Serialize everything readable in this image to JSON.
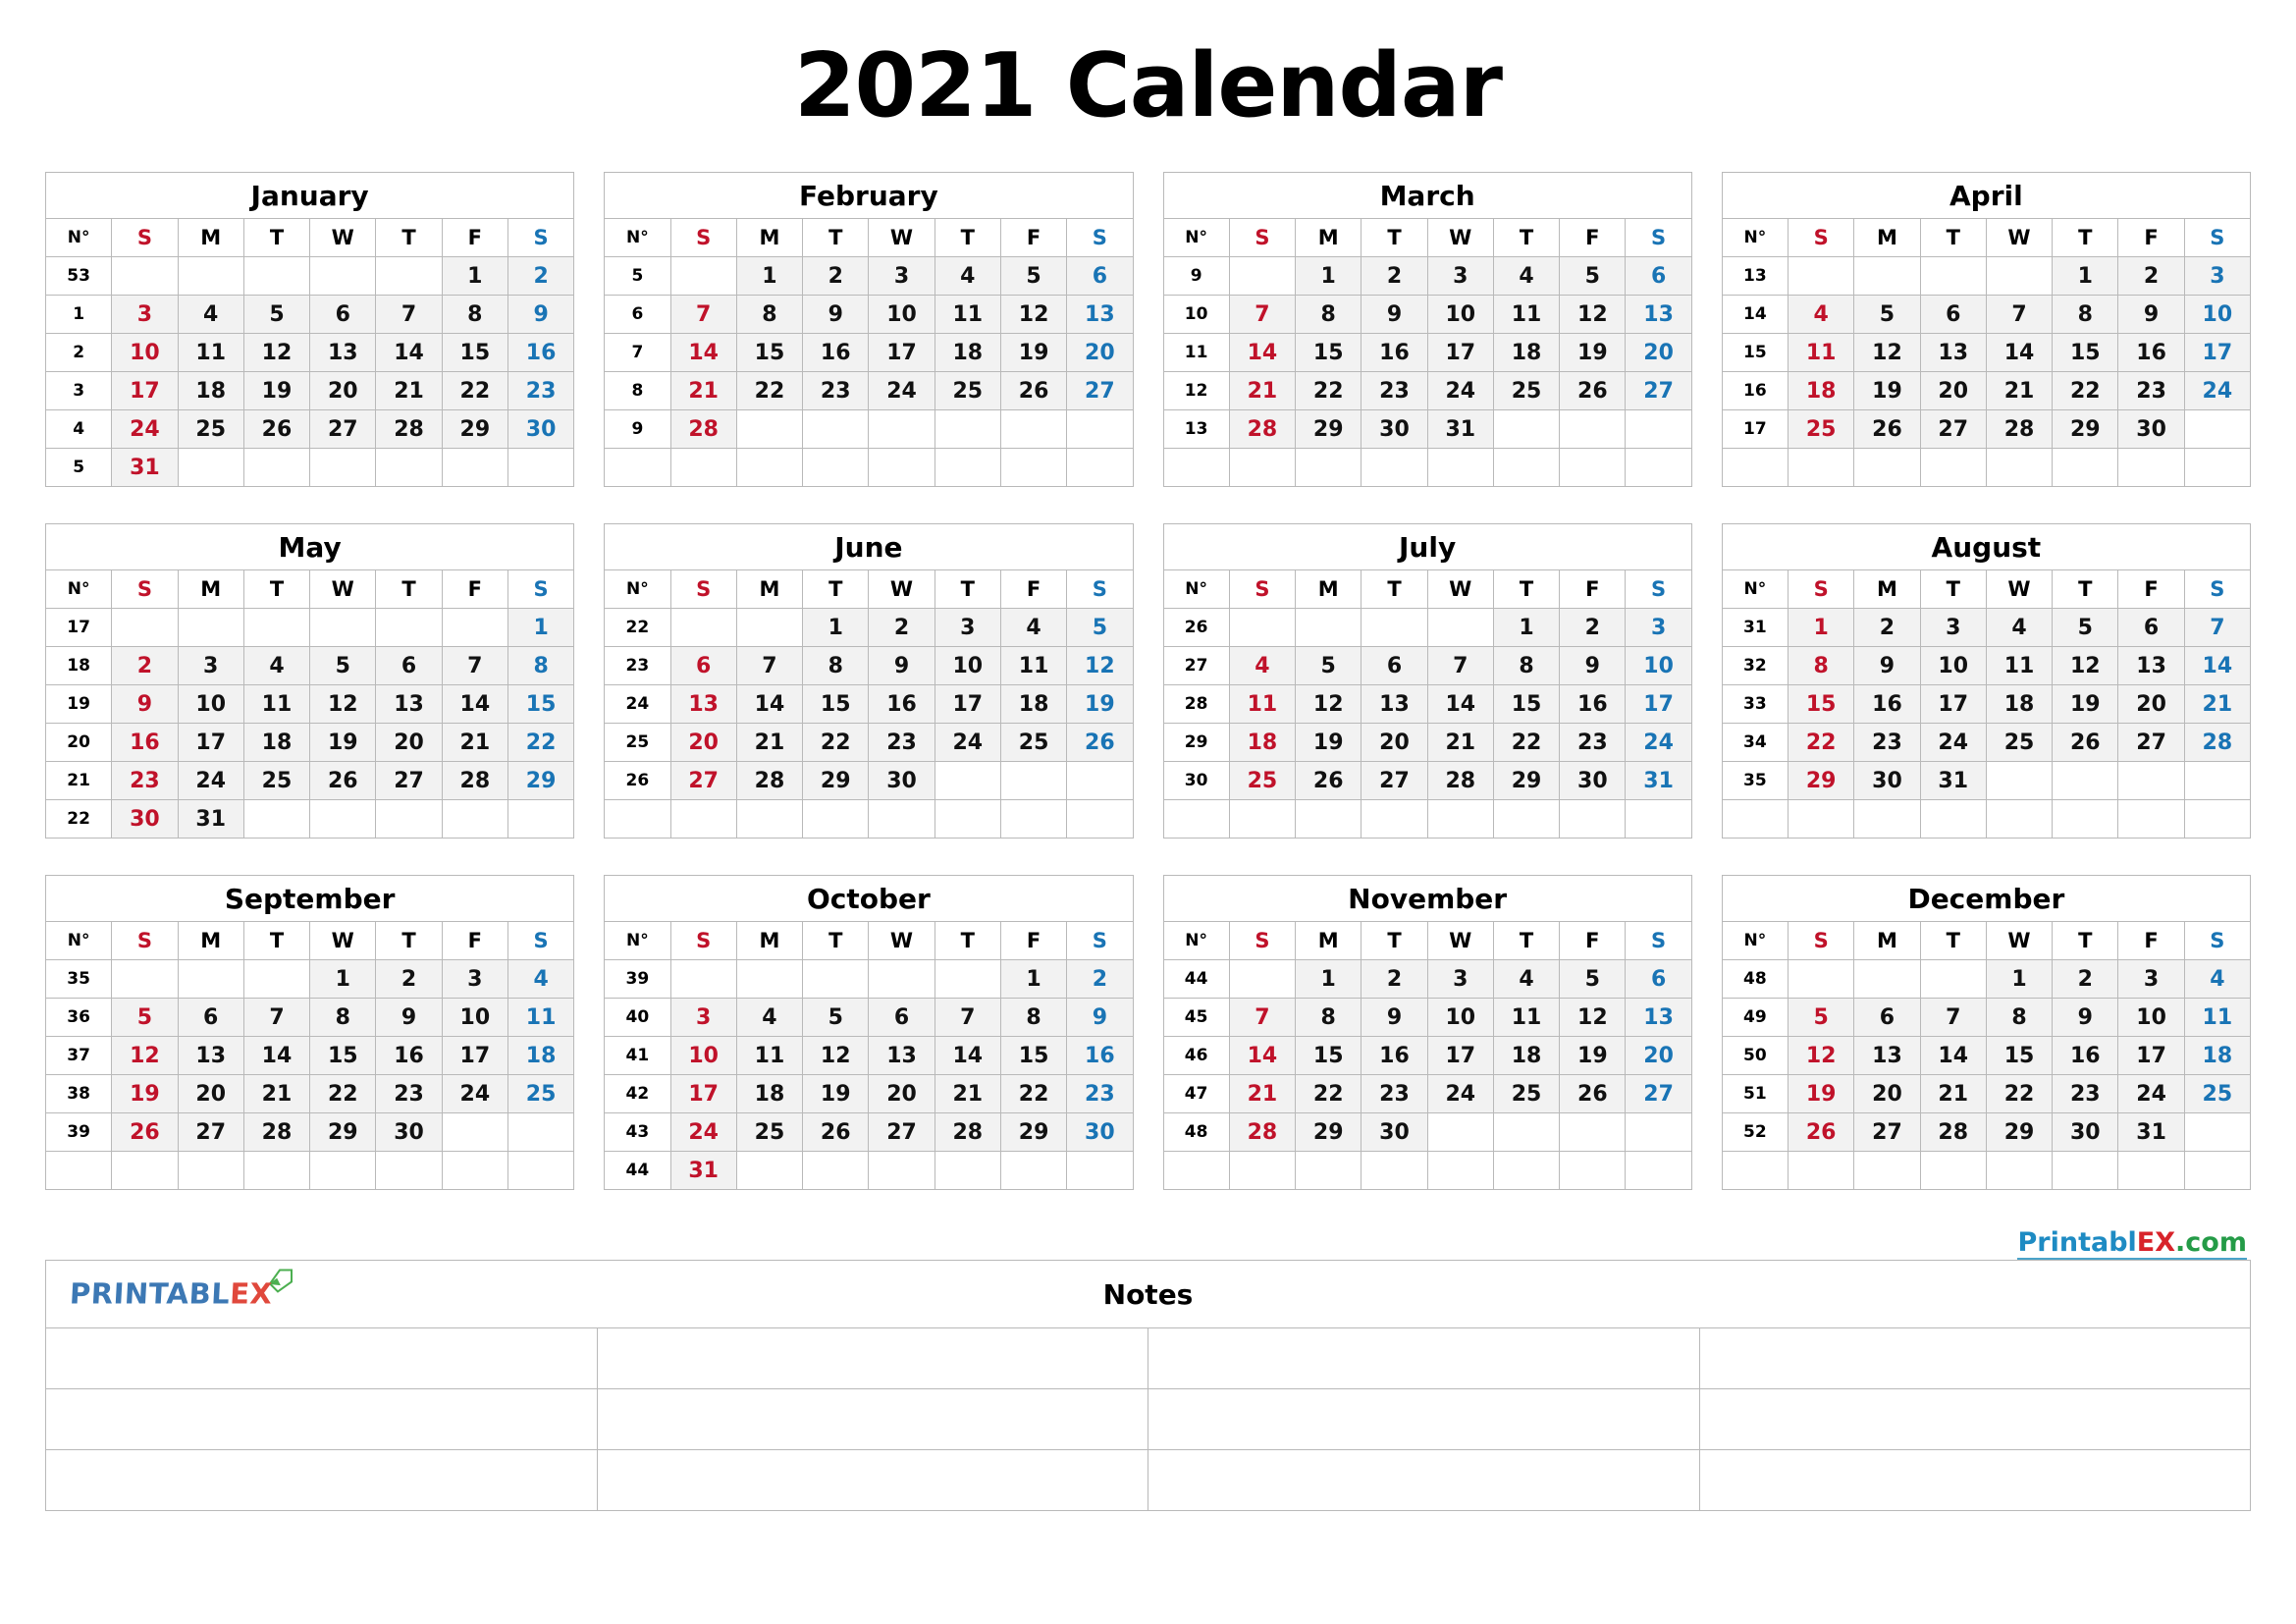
{
  "title": "2021 Calendar",
  "weekday_headers": {
    "week_number": "N°",
    "days": [
      "S",
      "M",
      "T",
      "W",
      "T",
      "F",
      "S"
    ]
  },
  "brand": {
    "top_right": {
      "part1": "Printabl",
      "part2": "EX",
      "part3": ".com"
    },
    "footer_logo": {
      "part1": "PRINTABL",
      "part2": "EX",
      "icon": "tag-icon"
    }
  },
  "notes": {
    "title": "Notes",
    "rows": 3,
    "columns": 4
  },
  "months": [
    {
      "name": "January",
      "weeks": [
        {
          "n": "53",
          "days": [
            "",
            "",
            "",
            "",
            "",
            "1",
            "2"
          ]
        },
        {
          "n": "1",
          "days": [
            "3",
            "4",
            "5",
            "6",
            "7",
            "8",
            "9"
          ]
        },
        {
          "n": "2",
          "days": [
            "10",
            "11",
            "12",
            "13",
            "14",
            "15",
            "16"
          ]
        },
        {
          "n": "3",
          "days": [
            "17",
            "18",
            "19",
            "20",
            "21",
            "22",
            "23"
          ]
        },
        {
          "n": "4",
          "days": [
            "24",
            "25",
            "26",
            "27",
            "28",
            "29",
            "30"
          ]
        },
        {
          "n": "5",
          "days": [
            "31",
            "",
            "",
            "",
            "",
            "",
            ""
          ]
        }
      ]
    },
    {
      "name": "February",
      "weeks": [
        {
          "n": "5",
          "days": [
            "",
            "1",
            "2",
            "3",
            "4",
            "5",
            "6"
          ]
        },
        {
          "n": "6",
          "days": [
            "7",
            "8",
            "9",
            "10",
            "11",
            "12",
            "13"
          ]
        },
        {
          "n": "7",
          "days": [
            "14",
            "15",
            "16",
            "17",
            "18",
            "19",
            "20"
          ]
        },
        {
          "n": "8",
          "days": [
            "21",
            "22",
            "23",
            "24",
            "25",
            "26",
            "27"
          ]
        },
        {
          "n": "9",
          "days": [
            "28",
            "",
            "",
            "",
            "",
            "",
            ""
          ]
        },
        {
          "n": "",
          "days": [
            "",
            "",
            "",
            "",
            "",
            "",
            ""
          ]
        }
      ]
    },
    {
      "name": "March",
      "weeks": [
        {
          "n": "9",
          "days": [
            "",
            "1",
            "2",
            "3",
            "4",
            "5",
            "6"
          ]
        },
        {
          "n": "10",
          "days": [
            "7",
            "8",
            "9",
            "10",
            "11",
            "12",
            "13"
          ]
        },
        {
          "n": "11",
          "days": [
            "14",
            "15",
            "16",
            "17",
            "18",
            "19",
            "20"
          ]
        },
        {
          "n": "12",
          "days": [
            "21",
            "22",
            "23",
            "24",
            "25",
            "26",
            "27"
          ]
        },
        {
          "n": "13",
          "days": [
            "28",
            "29",
            "30",
            "31",
            "",
            "",
            ""
          ]
        },
        {
          "n": "",
          "days": [
            "",
            "",
            "",
            "",
            "",
            "",
            ""
          ]
        }
      ]
    },
    {
      "name": "April",
      "weeks": [
        {
          "n": "13",
          "days": [
            "",
            "",
            "",
            "",
            "1",
            "2",
            "3"
          ]
        },
        {
          "n": "14",
          "days": [
            "4",
            "5",
            "6",
            "7",
            "8",
            "9",
            "10"
          ]
        },
        {
          "n": "15",
          "days": [
            "11",
            "12",
            "13",
            "14",
            "15",
            "16",
            "17"
          ]
        },
        {
          "n": "16",
          "days": [
            "18",
            "19",
            "20",
            "21",
            "22",
            "23",
            "24"
          ]
        },
        {
          "n": "17",
          "days": [
            "25",
            "26",
            "27",
            "28",
            "29",
            "30",
            ""
          ]
        },
        {
          "n": "",
          "days": [
            "",
            "",
            "",
            "",
            "",
            "",
            ""
          ]
        }
      ]
    },
    {
      "name": "May",
      "weeks": [
        {
          "n": "17",
          "days": [
            "",
            "",
            "",
            "",
            "",
            "",
            "1"
          ]
        },
        {
          "n": "18",
          "days": [
            "2",
            "3",
            "4",
            "5",
            "6",
            "7",
            "8"
          ]
        },
        {
          "n": "19",
          "days": [
            "9",
            "10",
            "11",
            "12",
            "13",
            "14",
            "15"
          ]
        },
        {
          "n": "20",
          "days": [
            "16",
            "17",
            "18",
            "19",
            "20",
            "21",
            "22"
          ]
        },
        {
          "n": "21",
          "days": [
            "23",
            "24",
            "25",
            "26",
            "27",
            "28",
            "29"
          ]
        },
        {
          "n": "22",
          "days": [
            "30",
            "31",
            "",
            "",
            "",
            "",
            ""
          ]
        }
      ]
    },
    {
      "name": "June",
      "weeks": [
        {
          "n": "22",
          "days": [
            "",
            "",
            "1",
            "2",
            "3",
            "4",
            "5"
          ]
        },
        {
          "n": "23",
          "days": [
            "6",
            "7",
            "8",
            "9",
            "10",
            "11",
            "12"
          ]
        },
        {
          "n": "24",
          "days": [
            "13",
            "14",
            "15",
            "16",
            "17",
            "18",
            "19"
          ]
        },
        {
          "n": "25",
          "days": [
            "20",
            "21",
            "22",
            "23",
            "24",
            "25",
            "26"
          ]
        },
        {
          "n": "26",
          "days": [
            "27",
            "28",
            "29",
            "30",
            "",
            "",
            ""
          ]
        },
        {
          "n": "",
          "days": [
            "",
            "",
            "",
            "",
            "",
            "",
            ""
          ]
        }
      ]
    },
    {
      "name": "July",
      "weeks": [
        {
          "n": "26",
          "days": [
            "",
            "",
            "",
            "",
            "1",
            "2",
            "3"
          ]
        },
        {
          "n": "27",
          "days": [
            "4",
            "5",
            "6",
            "7",
            "8",
            "9",
            "10"
          ]
        },
        {
          "n": "28",
          "days": [
            "11",
            "12",
            "13",
            "14",
            "15",
            "16",
            "17"
          ]
        },
        {
          "n": "29",
          "days": [
            "18",
            "19",
            "20",
            "21",
            "22",
            "23",
            "24"
          ]
        },
        {
          "n": "30",
          "days": [
            "25",
            "26",
            "27",
            "28",
            "29",
            "30",
            "31"
          ]
        },
        {
          "n": "",
          "days": [
            "",
            "",
            "",
            "",
            "",
            "",
            ""
          ]
        }
      ]
    },
    {
      "name": "August",
      "weeks": [
        {
          "n": "31",
          "days": [
            "1",
            "2",
            "3",
            "4",
            "5",
            "6",
            "7"
          ]
        },
        {
          "n": "32",
          "days": [
            "8",
            "9",
            "10",
            "11",
            "12",
            "13",
            "14"
          ]
        },
        {
          "n": "33",
          "days": [
            "15",
            "16",
            "17",
            "18",
            "19",
            "20",
            "21"
          ]
        },
        {
          "n": "34",
          "days": [
            "22",
            "23",
            "24",
            "25",
            "26",
            "27",
            "28"
          ]
        },
        {
          "n": "35",
          "days": [
            "29",
            "30",
            "31",
            "",
            "",
            "",
            ""
          ]
        },
        {
          "n": "",
          "days": [
            "",
            "",
            "",
            "",
            "",
            "",
            ""
          ]
        }
      ]
    },
    {
      "name": "September",
      "weeks": [
        {
          "n": "35",
          "days": [
            "",
            "",
            "",
            "1",
            "2",
            "3",
            "4"
          ]
        },
        {
          "n": "36",
          "days": [
            "5",
            "6",
            "7",
            "8",
            "9",
            "10",
            "11"
          ]
        },
        {
          "n": "37",
          "days": [
            "12",
            "13",
            "14",
            "15",
            "16",
            "17",
            "18"
          ]
        },
        {
          "n": "38",
          "days": [
            "19",
            "20",
            "21",
            "22",
            "23",
            "24",
            "25"
          ]
        },
        {
          "n": "39",
          "days": [
            "26",
            "27",
            "28",
            "29",
            "30",
            "",
            ""
          ]
        },
        {
          "n": "",
          "days": [
            "",
            "",
            "",
            "",
            "",
            "",
            ""
          ]
        }
      ]
    },
    {
      "name": "October",
      "weeks": [
        {
          "n": "39",
          "days": [
            "",
            "",
            "",
            "",
            "",
            "1",
            "2"
          ]
        },
        {
          "n": "40",
          "days": [
            "3",
            "4",
            "5",
            "6",
            "7",
            "8",
            "9"
          ]
        },
        {
          "n": "41",
          "days": [
            "10",
            "11",
            "12",
            "13",
            "14",
            "15",
            "16"
          ]
        },
        {
          "n": "42",
          "days": [
            "17",
            "18",
            "19",
            "20",
            "21",
            "22",
            "23"
          ]
        },
        {
          "n": "43",
          "days": [
            "24",
            "25",
            "26",
            "27",
            "28",
            "29",
            "30"
          ]
        },
        {
          "n": "44",
          "days": [
            "31",
            "",
            "",
            "",
            "",
            "",
            ""
          ]
        }
      ]
    },
    {
      "name": "November",
      "weeks": [
        {
          "n": "44",
          "days": [
            "",
            "1",
            "2",
            "3",
            "4",
            "5",
            "6"
          ]
        },
        {
          "n": "45",
          "days": [
            "7",
            "8",
            "9",
            "10",
            "11",
            "12",
            "13"
          ]
        },
        {
          "n": "46",
          "days": [
            "14",
            "15",
            "16",
            "17",
            "18",
            "19",
            "20"
          ]
        },
        {
          "n": "47",
          "days": [
            "21",
            "22",
            "23",
            "24",
            "25",
            "26",
            "27"
          ]
        },
        {
          "n": "48",
          "days": [
            "28",
            "29",
            "30",
            "",
            "",
            "",
            ""
          ]
        },
        {
          "n": "",
          "days": [
            "",
            "",
            "",
            "",
            "",
            "",
            ""
          ]
        }
      ]
    },
    {
      "name": "December",
      "weeks": [
        {
          "n": "48",
          "days": [
            "",
            "",
            "",
            "1",
            "2",
            "3",
            "4"
          ]
        },
        {
          "n": "49",
          "days": [
            "5",
            "6",
            "7",
            "8",
            "9",
            "10",
            "11"
          ]
        },
        {
          "n": "50",
          "days": [
            "12",
            "13",
            "14",
            "15",
            "16",
            "17",
            "18"
          ]
        },
        {
          "n": "51",
          "days": [
            "19",
            "20",
            "21",
            "22",
            "23",
            "24",
            "25"
          ]
        },
        {
          "n": "52",
          "days": [
            "26",
            "27",
            "28",
            "29",
            "30",
            "31",
            ""
          ]
        },
        {
          "n": "",
          "days": [
            "",
            "",
            "",
            "",
            "",
            "",
            ""
          ]
        }
      ]
    }
  ],
  "colors": {
    "sunday": "#C0122A",
    "saturday": "#1974B5",
    "weekday": "#111111",
    "cell_fill": "#f2f2f2",
    "border": "#b9b9b9"
  }
}
